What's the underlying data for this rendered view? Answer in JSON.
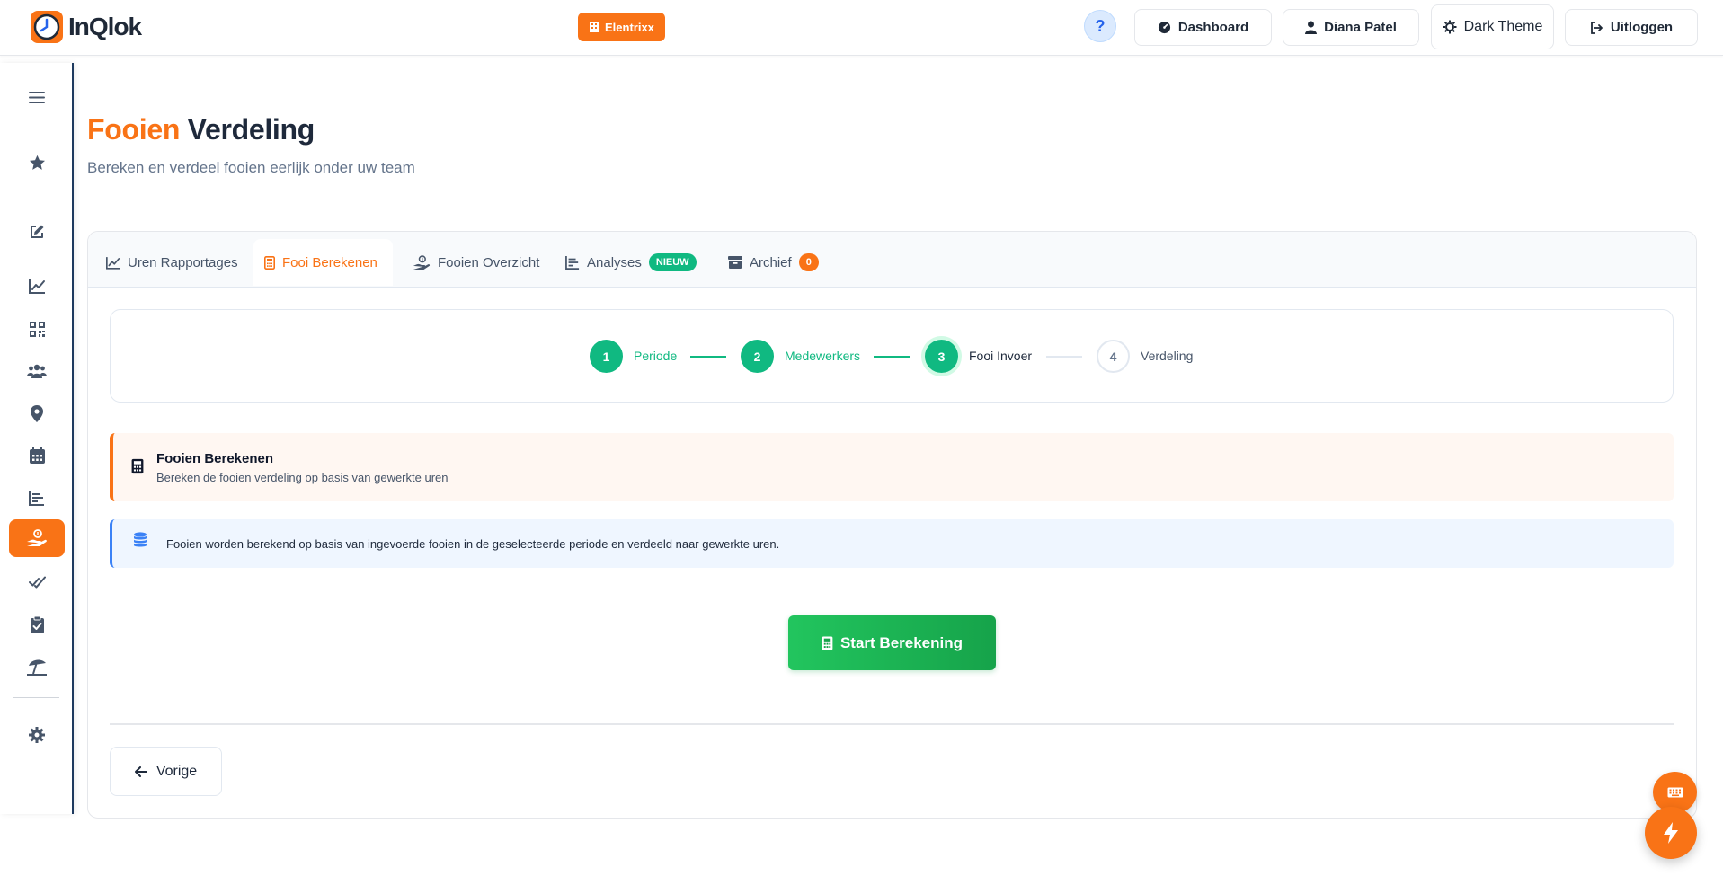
{
  "header": {
    "logo_text": "InQlok",
    "company": "Elentrixx",
    "help_label": "?",
    "dashboard_label": "Dashboard",
    "user_label": "Diana Patel",
    "theme_label": "Dark Theme",
    "logout_label": "Uitloggen"
  },
  "sidebar": {
    "items": [
      {
        "icon": "menu-icon"
      },
      {
        "icon": "star-icon"
      },
      {
        "icon": "edit-icon"
      },
      {
        "icon": "chart-line-icon"
      },
      {
        "icon": "qrcode-icon"
      },
      {
        "icon": "users-icon"
      },
      {
        "icon": "location-pin-icon"
      },
      {
        "icon": "calendar-icon"
      },
      {
        "icon": "bar-chart-icon"
      },
      {
        "icon": "hand-coins-icon",
        "active": true
      },
      {
        "icon": "double-check-icon"
      },
      {
        "icon": "clipboard-check-icon"
      },
      {
        "icon": "beach-umbrella-icon"
      },
      {
        "icon": "gear-icon"
      }
    ]
  },
  "page": {
    "title_accent": "Fooien",
    "title_rest": " Verdeling",
    "subtitle": "Bereken en verdeel fooien eerlijk onder uw team"
  },
  "tabs": [
    {
      "label": "Uren Rapportages",
      "icon": "chart-line-icon"
    },
    {
      "label": "Fooi Berekenen",
      "icon": "calculator-icon",
      "active": true
    },
    {
      "label": "Fooien Overzicht",
      "icon": "hand-coins-icon"
    },
    {
      "label": "Analyses",
      "icon": "bar-chart-icon",
      "badge": "NIEUW"
    },
    {
      "label": "Archief",
      "icon": "archive-icon",
      "badge": "0"
    }
  ],
  "stepper": {
    "steps": [
      {
        "number": "1",
        "label": "Periode",
        "state": "done"
      },
      {
        "number": "2",
        "label": "Medewerkers",
        "state": "done"
      },
      {
        "number": "3",
        "label": "Fooi Invoer",
        "state": "current"
      },
      {
        "number": "4",
        "label": "Verdeling",
        "state": "todo"
      }
    ]
  },
  "section": {
    "title": "Fooien Berekenen",
    "description": "Bereken de fooien verdeling op basis van gewerkte uren"
  },
  "info": {
    "text": "Fooien worden berekend op basis van ingevoerde fooien in de geselecteerde periode en verdeeld naar gewerkte uren."
  },
  "actions": {
    "start_label": "Start Berekening",
    "back_label": "Vorige"
  },
  "colors": {
    "accent": "#f97316",
    "success": "#10b981",
    "info": "#3b82f6"
  }
}
